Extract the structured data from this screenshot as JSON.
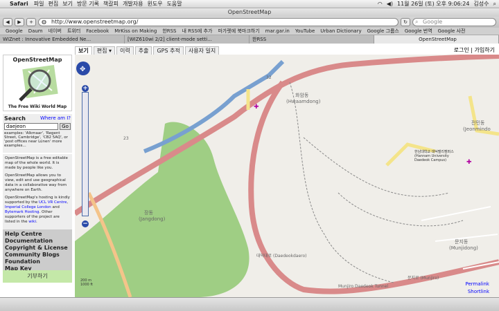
{
  "menubar": {
    "app": "Safari",
    "items": [
      "파일",
      "편집",
      "보기",
      "방문 기록",
      "책갈피",
      "개발자용",
      "윈도우",
      "도움말"
    ],
    "datetime": "11월 26일 (토) 오후  9:06:24",
    "user": "김성수"
  },
  "window": {
    "title": "OpenStreetMap"
  },
  "toolbar": {
    "url": "http://www.openstreetmap.org/",
    "search_placeholder": "Google"
  },
  "bookmarks": [
    "Google",
    "Daum",
    "네이버",
    "트위터",
    "Facebook",
    "MrKiss on Making",
    "한RSS",
    "내 RSS에 추가",
    "마가렛에 북마크하기",
    "mar.gar.in",
    "YouTube",
    "Urban Dictionary",
    "Google 그룹스",
    "Google 번역",
    "Google 사전"
  ],
  "tabs": [
    "WIZnet : Innovative Embedded Ne...",
    "[WIZ610wi 2/2] client-mode setti...",
    "한RSS",
    "OpenStreetMap"
  ],
  "osm_tabs": [
    "보기",
    "편집 ▾",
    "이력",
    "추출",
    "GPS 추적",
    "사용자 일지"
  ],
  "login": "로그인 | 가입하기",
  "logo": {
    "title": "OpenStreetMap",
    "subtitle": "The Free Wiki World Map"
  },
  "search": {
    "title": "Search",
    "where": "Where am I?",
    "value": "daejeon",
    "go": "Go",
    "examples": "examples: 'Alkmaar', 'Regent Street, Cambridge', 'CB2 5AQ', or 'post offices near Lünen' more examples..."
  },
  "info": {
    "p1": "OpenStreetMap is a free editable map of the whole world. It is made by people like you.",
    "p2": "OpenStreetMap allows you to view, edit and use geographical data in a collaborative way from anywhere on Earth.",
    "p3a": "OpenStreetMap's hosting is kindly supported by the ",
    "p3b": "UCL VR Centre",
    "p3c": ", ",
    "p3d": "Imperial College London",
    "p3e": " and ",
    "p3f": "Bytemark Hosting",
    "p3g": ". Other supporters of the project are listed in the ",
    "p3h": "wiki",
    "p3i": "."
  },
  "links": [
    "Help Centre",
    "Documentation",
    "Copyright & License",
    "Community Blogs",
    "Foundation",
    "Map Key"
  ],
  "donate": "기부하기",
  "map": {
    "labels": {
      "hwaam": "화암동",
      "hwaam_en": "(Hwaamdong)",
      "jang": "장동",
      "jang_en": "(Jangdong)",
      "munji": "문지동",
      "munji_en": "(Munjidong)",
      "jeon": "전민동",
      "jeon_en": "(Jeonmindo",
      "hannam": "한남대학교 대덕밸리캠퍼스 (Hannam University Daedeok Campus)",
      "daedeok": "대덕대로 (Daedeokdaero)",
      "munjiro": "문지로 (Munjiro)",
      "tunnel": "Munjiro Daedeok Tunnel",
      "road32": "32",
      "road23": "23"
    },
    "scale_m": "200 m",
    "scale_ft": "1000 ft",
    "permalink": "Permalink",
    "shortlink": "Shortlink"
  }
}
